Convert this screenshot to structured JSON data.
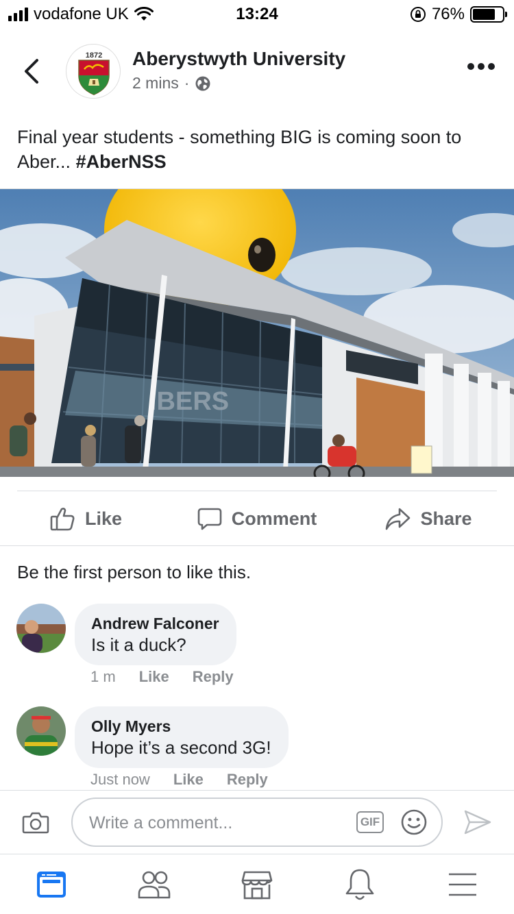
{
  "status_bar": {
    "carrier": "vodafone UK",
    "time": "13:24",
    "battery": "76%",
    "battery_level": 0.76
  },
  "post": {
    "page_name": "Aberystwyth University",
    "time_ago": "2 mins",
    "separator": "·",
    "logo_year": "1872",
    "text": "Final year students - something BIG is coming soon to Aber... ",
    "hashtag": "#AberNSS",
    "image_sign_text": "IBERS"
  },
  "actions": {
    "like": "Like",
    "comment": "Comment",
    "share": "Share"
  },
  "likes_summary": "Be the first person to like this.",
  "comments": [
    {
      "name": "Andrew Falconer",
      "text": "Is it a duck?",
      "time": "1 m",
      "like": "Like",
      "reply": "Reply"
    },
    {
      "name": "Olly Myers",
      "text": "Hope it’s a second 3G!",
      "time": "Just now",
      "like": "Like",
      "reply": "Reply"
    }
  ],
  "composer": {
    "placeholder": "Write a comment...",
    "gif": "GIF"
  },
  "tabbar": {
    "items": [
      "news-feed",
      "friends",
      "marketplace",
      "notifications",
      "menu"
    ],
    "active": "news-feed"
  },
  "colors": {
    "accent": "#1877f2",
    "icon_gray": "#65676b",
    "bubble": "#f0f2f5"
  }
}
